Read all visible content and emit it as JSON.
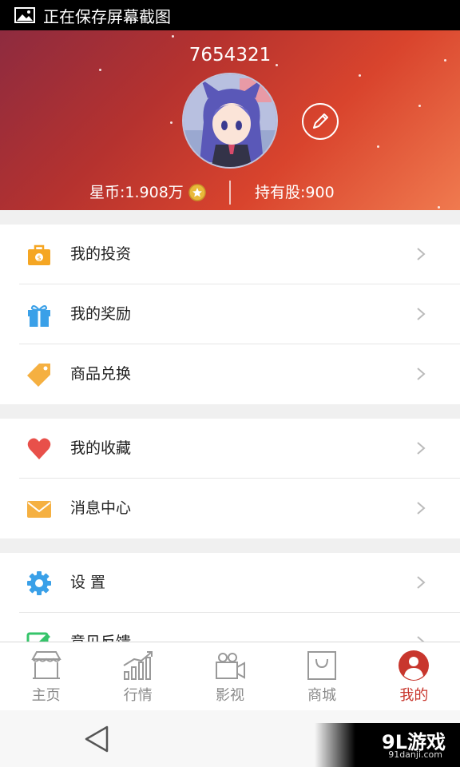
{
  "status_bar": {
    "text": "正在保存屏幕截图"
  },
  "profile": {
    "user_id": "7654321",
    "coins_label": "星币:1.908万",
    "shares_label": "持有股:900"
  },
  "menu_groups": [
    [
      {
        "label": "我的投资",
        "icon": "briefcase-icon",
        "color": "#f5a623"
      },
      {
        "label": "我的奖励",
        "icon": "gift-icon",
        "color": "#3aa0e8"
      },
      {
        "label": "商品兑换",
        "icon": "tag-icon",
        "color": "#f5b041"
      }
    ],
    [
      {
        "label": "我的收藏",
        "icon": "heart-icon",
        "color": "#e8504a"
      },
      {
        "label": "消息中心",
        "icon": "envelope-icon",
        "color": "#f5b041"
      }
    ],
    [
      {
        "label": "设 置",
        "icon": "gear-icon",
        "color": "#3aa0e8"
      },
      {
        "label": "意见反馈",
        "icon": "feedback-icon",
        "color": "#35c46a"
      }
    ]
  ],
  "tabs": [
    {
      "label": "主页",
      "icon": "shop-icon"
    },
    {
      "label": "行情",
      "icon": "chart-icon"
    },
    {
      "label": "影视",
      "icon": "video-camera-icon"
    },
    {
      "label": "商城",
      "icon": "shopping-bag-icon"
    },
    {
      "label": "我的",
      "icon": "profile-icon",
      "active": true
    }
  ],
  "colors": {
    "accent": "#c8362d",
    "header_start": "#8e2b3f",
    "header_end": "#f07a4f"
  },
  "watermark": {
    "main": "9L游戏",
    "sub": "91danji.com"
  }
}
